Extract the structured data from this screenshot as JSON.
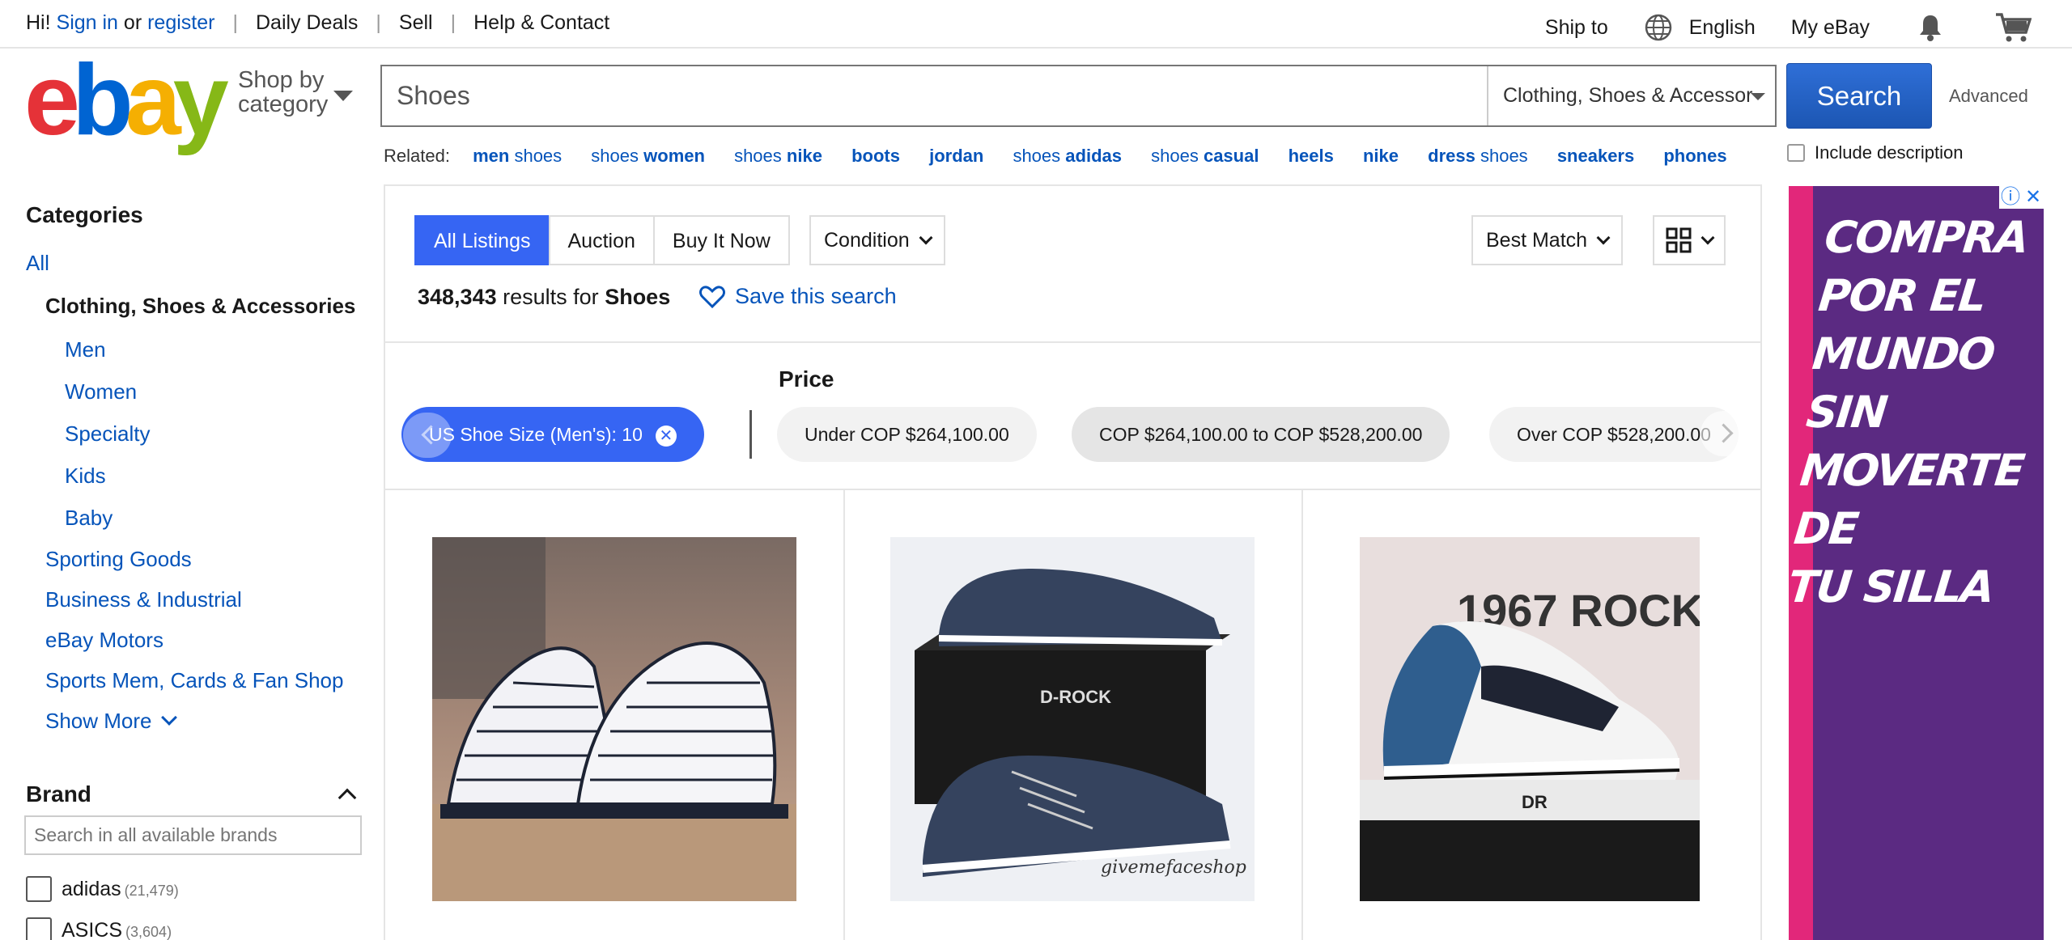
{
  "topbar": {
    "greeting": "Hi!",
    "sign_in": "Sign in",
    "or": "or",
    "register": "register",
    "daily_deals": "Daily Deals",
    "sell": "Sell",
    "help": "Help & Contact",
    "ship_to": "Ship to",
    "language": "English",
    "my_ebay": "My eBay"
  },
  "logo": {
    "e": "e",
    "b": "b",
    "a": "a",
    "y": "y"
  },
  "shop_by_category": {
    "line1": "Shop by",
    "line2": "category"
  },
  "search": {
    "value": "Shoes",
    "category": "Clothing, Shoes & Accessories",
    "button": "Search",
    "advanced": "Advanced",
    "include_description": "Include description"
  },
  "related": {
    "label": "Related:",
    "items": [
      {
        "a": "men",
        "b": "shoes"
      },
      {
        "a": "shoes",
        "b": "women"
      },
      {
        "a": "shoes",
        "b": "nike"
      },
      {
        "a": "",
        "b": "boots"
      },
      {
        "a": "",
        "b": "jordan"
      },
      {
        "a": "shoes",
        "b": "adidas"
      },
      {
        "a": "shoes",
        "b": "casual"
      },
      {
        "a": "",
        "b": "heels"
      },
      {
        "a": "",
        "b": "nike"
      },
      {
        "a": "dress",
        "b": "shoes"
      },
      {
        "a": "",
        "b": "sneakers"
      },
      {
        "a": "",
        "b": "phones"
      }
    ]
  },
  "sidebar": {
    "title": "Categories",
    "all": "All",
    "current": "Clothing, Shoes & Accessories",
    "sub": [
      "Men",
      "Women",
      "Specialty",
      "Kids",
      "Baby"
    ],
    "other": [
      "Sporting Goods",
      "Business & Industrial",
      "eBay Motors",
      "Sports Mem, Cards & Fan Shop"
    ],
    "show_more": "Show More",
    "brand_title": "Brand",
    "brand_search_placeholder": "Search in all available brands",
    "brands": [
      {
        "name": "adidas",
        "count": "(21,479)"
      },
      {
        "name": "ASICS",
        "count": "(3,604)"
      }
    ]
  },
  "main": {
    "tabs": [
      "All Listings",
      "Auction",
      "Buy It Now"
    ],
    "condition": "Condition",
    "sort": "Best Match",
    "results_count": "348,343",
    "results_for": "results for",
    "query": "Shoes",
    "save_search": "Save this search",
    "price_label": "Price",
    "active_filter": "US Shoe Size (Men's): 10",
    "price_pills": [
      "Under COP $264,100.00",
      "COP $264,100.00 to COP $528,200.00",
      "Over COP $528,200.00"
    ]
  },
  "products": [
    {
      "brand_text": ""
    },
    {
      "brand_text": "D-ROCK",
      "watermark": "givemefaceshop"
    },
    {
      "brand_text": "1967 ROCK",
      "box_text": "DR"
    }
  ],
  "ad": {
    "text_lines": [
      "COMPRA",
      "POR EL",
      "MUNDO SIN",
      "MOVERTE DE",
      "TU SILLA"
    ]
  },
  "colors": {
    "accent": "#3665f3",
    "link": "#0654ba",
    "logo_e": "#e53238",
    "logo_b": "#0064d2",
    "logo_a": "#f5af02",
    "logo_y": "#86b817",
    "ad_bg": "#5b2a82",
    "ad_stripe": "#e2277a"
  }
}
